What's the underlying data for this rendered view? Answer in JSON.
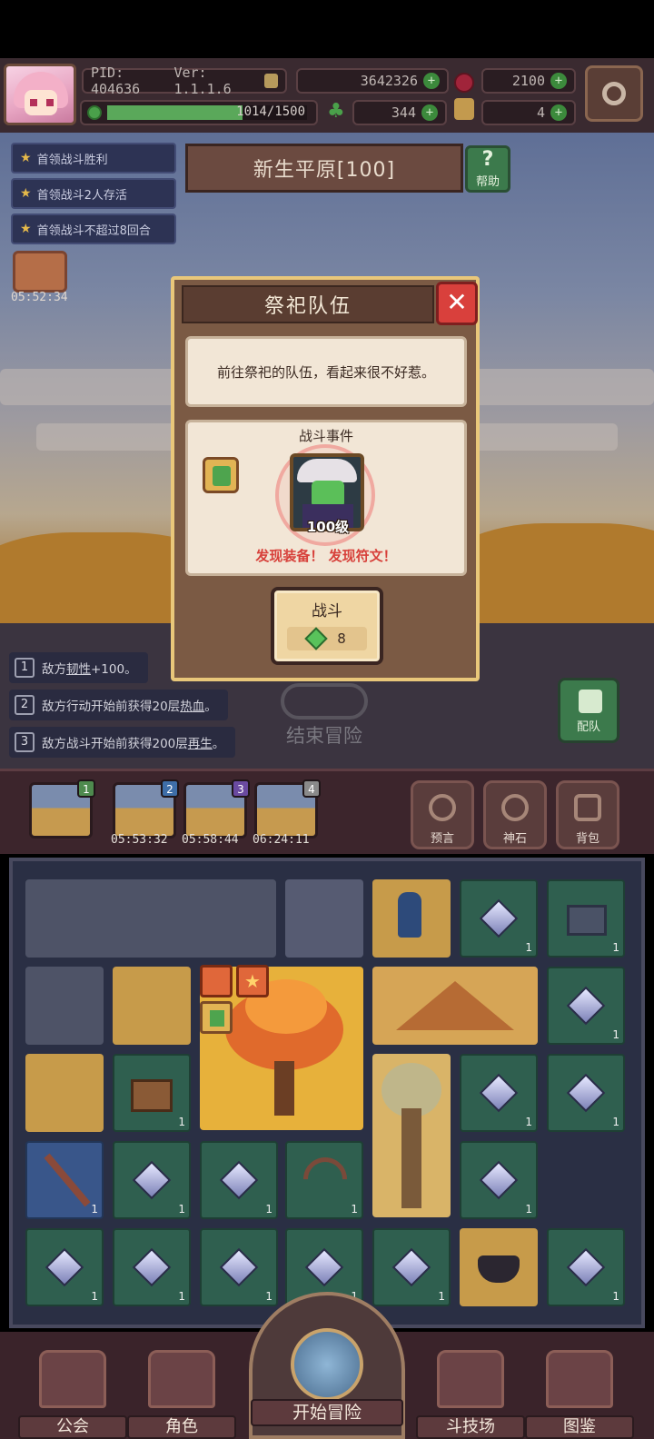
{
  "header": {
    "pid": "PID: 404636",
    "version": "Ver: 1.1.1.6",
    "gold": "3642326",
    "ruby": "2100",
    "energy": "1014/1500",
    "clover": "344",
    "keys": "4"
  },
  "quests": [
    "首领战斗胜利",
    "首领战斗2人存活",
    "首领战斗不超过8回合"
  ],
  "zone": {
    "title": "新生平原[100]",
    "help_label": "帮助"
  },
  "gift_timer": "05:52:34",
  "modal": {
    "title": "祭祀队伍",
    "close": "✕",
    "description": "前往祭祀的队伍，看起来很不好惹。",
    "event_title": "战斗事件",
    "enemy_level": "100级",
    "rewards": "发现装备！ 发现符文！",
    "fight_label": "战斗",
    "fight_cost": "8"
  },
  "enemy_buffs": [
    {
      "num": "1",
      "pre": "敌方",
      "kw": "韧性",
      "post": "+100。"
    },
    {
      "num": "2",
      "pre": "敌方行动开始前获得20层",
      "kw": "热血",
      "post": "。"
    },
    {
      "num": "3",
      "pre": "敌方战斗开始前获得200层",
      "kw": "再生",
      "post": "。"
    }
  ],
  "end_adventure": "结束冒险",
  "team_label": "配队",
  "slots": [
    {
      "badge": "1",
      "timer": ""
    },
    {
      "badge": "2",
      "timer": "05:53:32"
    },
    {
      "badge": "3",
      "timer": "05:58:44"
    },
    {
      "badge": "4",
      "timer": "06:24:11"
    }
  ],
  "side_buttons": [
    "预言",
    "神石",
    "背包"
  ],
  "tile_count": "1",
  "bottom_nav": [
    "公会",
    "角色",
    "开始冒险",
    "斗技场",
    "图鉴"
  ],
  "colors": {
    "accent_gold": "#e9c77a",
    "reward_red": "#d7403a",
    "green": "#4ea44e"
  }
}
